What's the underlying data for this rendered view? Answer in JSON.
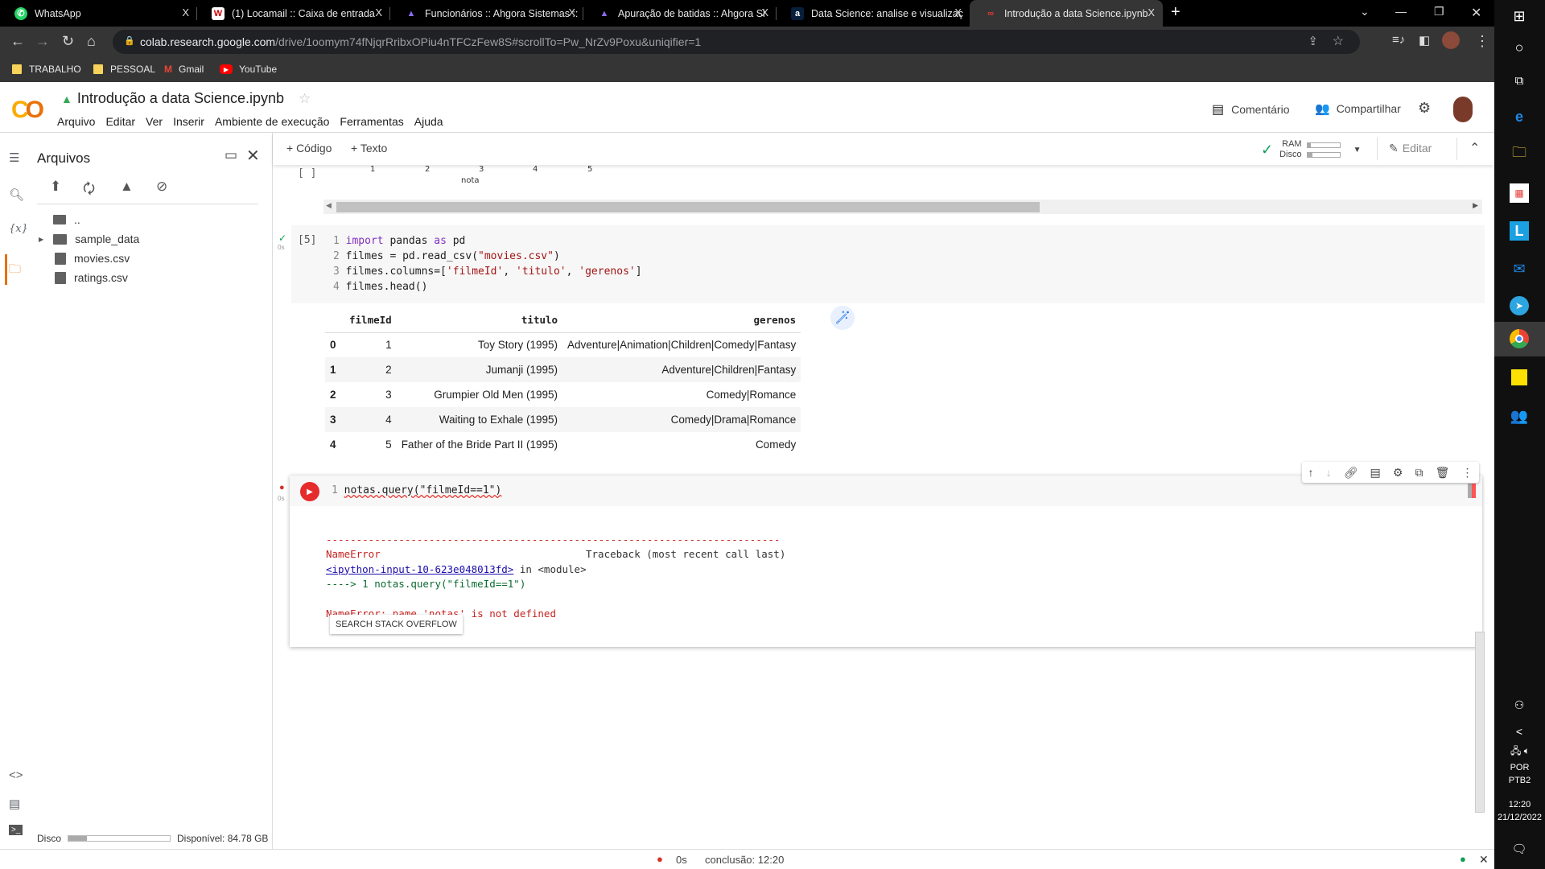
{
  "browser": {
    "tabs": [
      {
        "title": "WhatsApp",
        "icon": "whatsapp-icon",
        "active": false
      },
      {
        "title": "(1) Locamail :: Caixa de entrada",
        "icon": "locamail-icon",
        "active": false
      },
      {
        "title": "Funcionários :: Ahgora Sistemas ::",
        "icon": "ahgora-icon",
        "active": false
      },
      {
        "title": "Apuração de batidas :: Ahgora Si",
        "icon": "ahgora-icon",
        "active": false
      },
      {
        "title": "Data Science: analise e visualizaç",
        "icon": "alura-icon",
        "active": false
      },
      {
        "title": "Introdução a data Science.ipynb",
        "icon": "colab-icon",
        "active": true
      }
    ],
    "url_host": "colab.research.google.com",
    "url_path": "/drive/1oomym74fNjqrRribxOPiu4nTFCzFew8S#scrollTo=Pw_NrZv9Poxu&uniqifier=1",
    "bookmarks": [
      {
        "label": "TRABALHO",
        "icon": "folder-icon"
      },
      {
        "label": "PESSOAL",
        "icon": "folder-icon"
      },
      {
        "label": "Gmail",
        "icon": "gmail-icon"
      },
      {
        "label": "YouTube",
        "icon": "youtube-icon"
      }
    ],
    "close_glyph": "X"
  },
  "colab": {
    "logo": "CO",
    "notebook_title": "Introdução a data Science.ipynb",
    "menus": [
      "Arquivo",
      "Editar",
      "Ver",
      "Inserir",
      "Ambiente de execução",
      "Ferramentas",
      "Ajuda"
    ],
    "comment_label": "Comentário",
    "share_label": "Compartilhar",
    "toolbar": {
      "add_code": "+ Código",
      "add_text": "+ Texto",
      "ram_label": "RAM",
      "disk_label": "Disco",
      "ram_usage": 0.1,
      "disk_usage": 0.15,
      "edit_label": "Editar"
    }
  },
  "sidebar": {
    "title": "Arquivos",
    "files": [
      {
        "name": "..",
        "type": "parent-folder"
      },
      {
        "name": "sample_data",
        "type": "folder"
      },
      {
        "name": "movies.csv",
        "type": "file"
      },
      {
        "name": "ratings.csv",
        "type": "file"
      }
    ],
    "disk_label": "Disco",
    "disk_usage": 0.18,
    "disk_available": "Disponível: 84.78 GB"
  },
  "cells": {
    "prev_output": {
      "exec": "[ ]",
      "ticks": [
        "1",
        "2",
        "3",
        "4",
        "5"
      ],
      "xlabel": "nota"
    },
    "cell5": {
      "exec": "[5]",
      "time": "0s",
      "lines": [
        {
          "n": "1",
          "parts": [
            [
              "kw",
              "import"
            ],
            [
              "",
              " pandas "
            ],
            [
              "kw",
              "as"
            ],
            [
              "",
              " pd"
            ]
          ]
        },
        {
          "n": "2",
          "parts": [
            [
              "",
              "filmes = pd.read_csv("
            ],
            [
              "str",
              "\"movies.csv\""
            ],
            [
              "",
              ")"
            ]
          ]
        },
        {
          "n": "3",
          "parts": [
            [
              "",
              "filmes.columns=["
            ],
            [
              "str",
              "'filmeId'"
            ],
            [
              "",
              ", "
            ],
            [
              "str",
              "'titulo'"
            ],
            [
              "",
              ", "
            ],
            [
              "str",
              "'gerenos'"
            ],
            [
              "",
              "]"
            ]
          ]
        },
        {
          "n": "4",
          "parts": [
            [
              "",
              "filmes.head()"
            ]
          ]
        }
      ],
      "table": {
        "columns": [
          "",
          "filmeId",
          "titulo",
          "gerenos"
        ],
        "rows": [
          [
            "0",
            "1",
            "Toy Story (1995)",
            "Adventure|Animation|Children|Comedy|Fantasy"
          ],
          [
            "1",
            "2",
            "Jumanji (1995)",
            "Adventure|Children|Fantasy"
          ],
          [
            "2",
            "3",
            "Grumpier Old Men (1995)",
            "Comedy|Romance"
          ],
          [
            "3",
            "4",
            "Waiting to Exhale (1995)",
            "Comedy|Drama|Romance"
          ],
          [
            "4",
            "5",
            "Father of the Bride Part II (1995)",
            "Comedy"
          ]
        ]
      }
    },
    "cell_error": {
      "time": "0s",
      "line_no": "1",
      "code": "notas.query(\"filmeId==1\")",
      "traceback": {
        "dashes": "---------------------------------------------------------------------------",
        "error_name": "NameError",
        "traceback_label": "Traceback (most recent call last)",
        "input_link": "<ipython-input-10-623e048013fd>",
        "in_module": " in <module>",
        "arrow_line": "----> 1 notas.query(\"filmeId==1\")",
        "message": "NameError: name 'notas' is not defined"
      },
      "search_button": "SEARCH STACK OVERFLOW"
    }
  },
  "statusbar": {
    "time": "0s",
    "completion": "conclusão: 12:20"
  },
  "taskbar": {
    "language": "POR",
    "layout": "PTB2",
    "clock": "12:20",
    "date": "21/12/2022"
  }
}
